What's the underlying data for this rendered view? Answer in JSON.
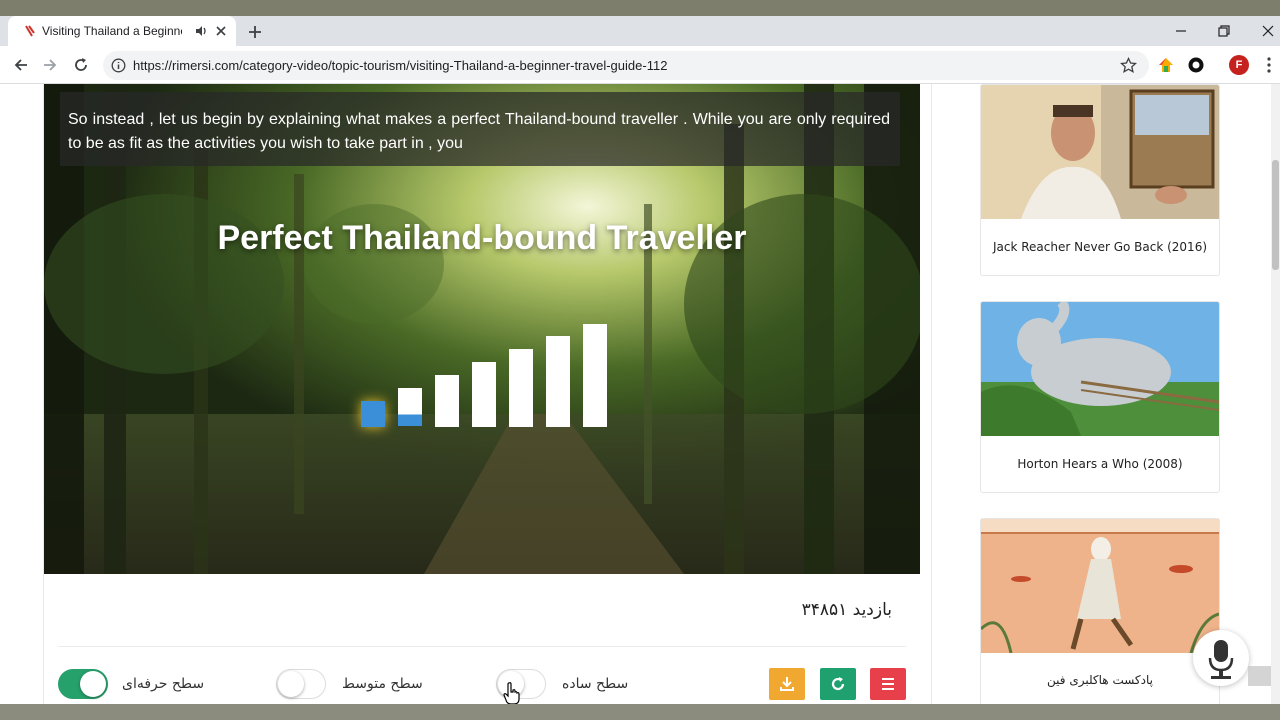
{
  "browser": {
    "tab_title": "Visiting Thailand a Beginner",
    "url": "https://rimersi.com/category-video/topic-tourism/visiting-Thailand-a-beginner-travel-guide-112",
    "profile_initial": "F"
  },
  "video": {
    "subtitle": "So instead , let us begin by explaining what makes a perfect Thailand-bound traveller . While you are only required to be as fit as the activities you wish to take part in , you",
    "title": "Perfect Thailand-bound Traveller",
    "level_bars": 7,
    "active_level": 1
  },
  "info": {
    "views_label": "بازدید ۳۴۸۵۱"
  },
  "levels": [
    {
      "label": "سطح حرفه‌ای",
      "on": true
    },
    {
      "label": "سطح متوسط",
      "on": false
    },
    {
      "label": "سطح ساده",
      "on": false
    }
  ],
  "actions": {
    "download_color": "#f0a830",
    "refresh_color": "#1ea06f",
    "menu_color": "#e8404a"
  },
  "sidebar": {
    "items": [
      {
        "title": "Jack Reacher Never Go Back (2016)"
      },
      {
        "title": "Horton Hears a Who (2008)"
      },
      {
        "title": "پادکست هاکلبری فین"
      }
    ]
  },
  "icons": [
    "audio-icon",
    "close-icon",
    "plus-icon",
    "back-arrow-icon",
    "forward-arrow-icon",
    "reload-icon",
    "info-icon",
    "star-icon",
    "download-icon",
    "refresh-icon",
    "hamburger-icon",
    "microphone-icon"
  ]
}
